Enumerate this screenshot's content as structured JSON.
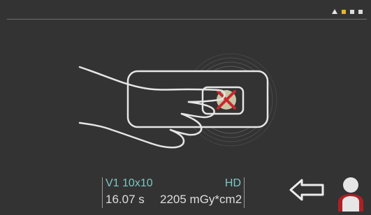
{
  "status": {
    "mode": "V1 10x10",
    "quality": "HD",
    "time": "16.07 s",
    "dose": "2205 mGy*cm2"
  },
  "indicators": [
    "triangle",
    "square-active",
    "square",
    "square"
  ],
  "icons": {
    "gesture": "hand-press-button-icon",
    "back": "back-arrow-icon",
    "user": "person-icon"
  },
  "colors": {
    "background": "#333333",
    "accent_text": "#7fc6c4",
    "active_indicator": "#e8b62a",
    "cancel_mark": "#c8282d"
  }
}
